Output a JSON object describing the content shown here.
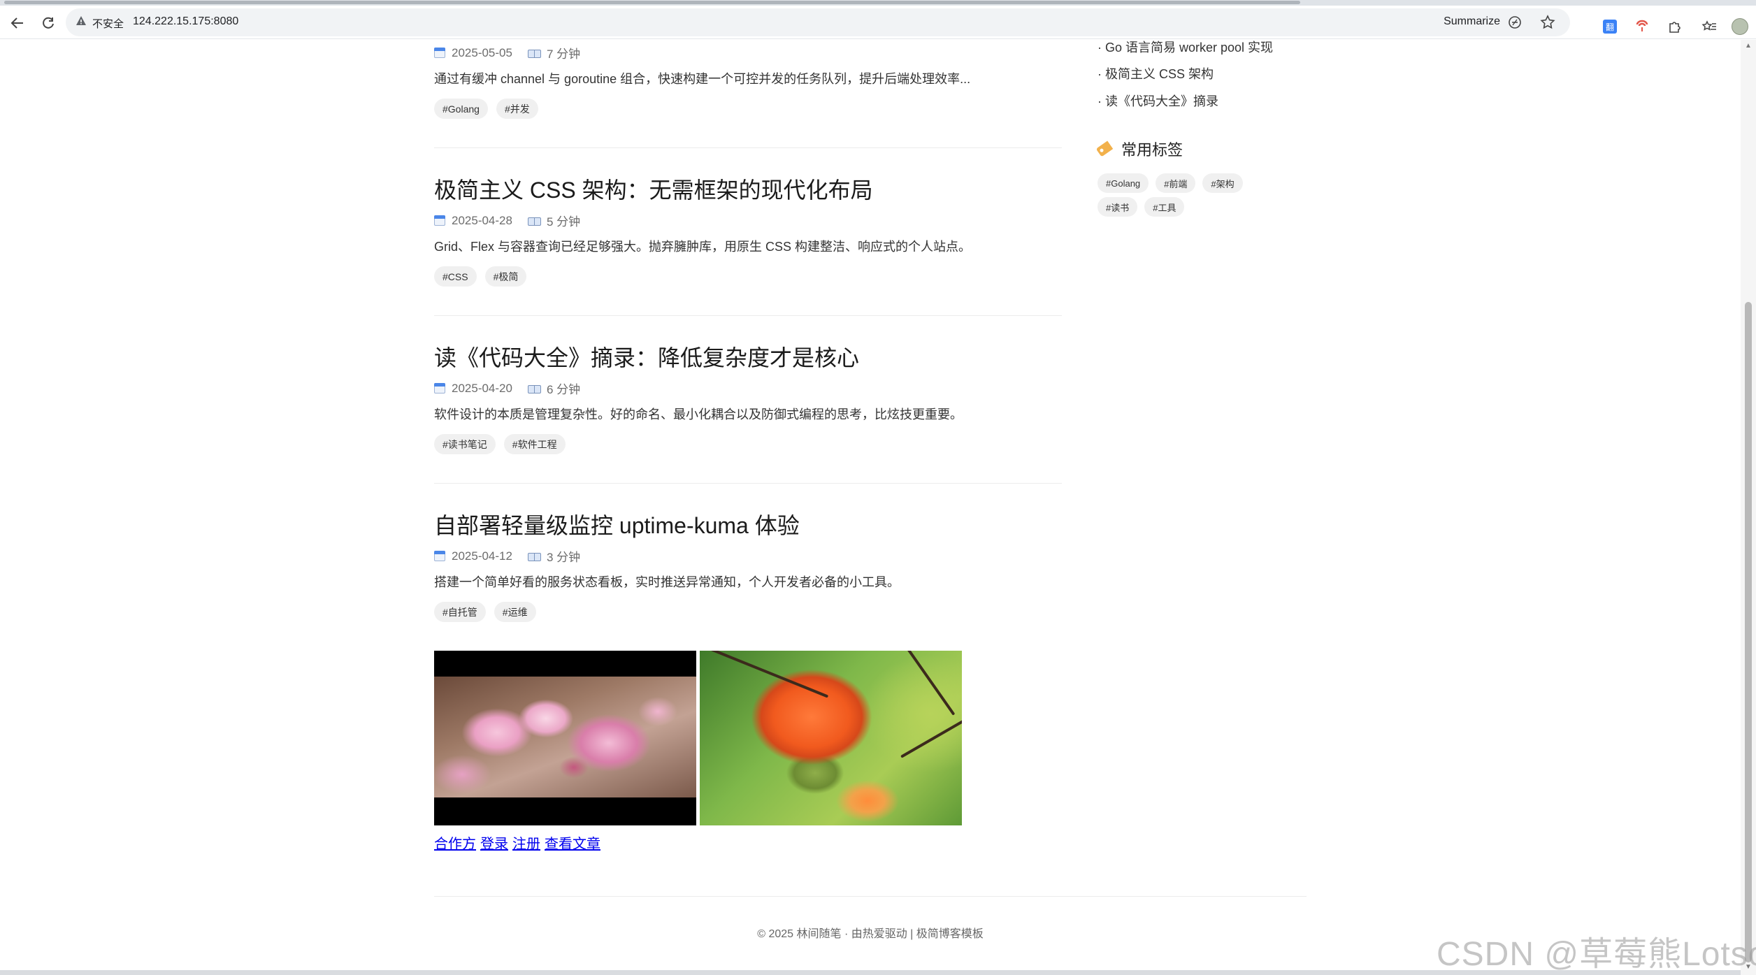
{
  "browser": {
    "security_label": "不安全",
    "url": "124.222.15.175:8080",
    "summarize_label": "Summarize",
    "extension_badge": "翻"
  },
  "articles": [
    {
      "title": "",
      "date": "2025-05-05",
      "read_time": "7 分钟",
      "excerpt": "通过有缓冲 channel 与 goroutine 组合，快速构建一个可控并发的任务队列，提升后端处理效率...",
      "tags": [
        "#Golang",
        "#并发"
      ]
    },
    {
      "title": "极简主义 CSS 架构：无需框架的现代化布局",
      "date": "2025-04-28",
      "read_time": "5 分钟",
      "excerpt": "Grid、Flex 与容器查询已经足够强大。抛弃臃肿库，用原生 CSS 构建整洁、响应式的个人站点。",
      "tags": [
        "#CSS",
        "#极简"
      ]
    },
    {
      "title": "读《代码大全》摘录：降低复杂度才是核心",
      "date": "2025-04-20",
      "read_time": "6 分钟",
      "excerpt": "软件设计的本质是管理复杂性。好的命名、最小化耦合以及防御式编程的思考，比炫技更重要。",
      "tags": [
        "#读书笔记",
        "#软件工程"
      ]
    },
    {
      "title": "自部署轻量级监控 uptime-kuma 体验",
      "date": "2025-04-12",
      "read_time": "3 分钟",
      "excerpt": "搭建一个简单好看的服务状态看板，实时推送异常通知，个人开发者必备的小工具。",
      "tags": [
        "#自托管",
        "#运维"
      ]
    }
  ],
  "links": [
    "合作方",
    "登录",
    "注册",
    "查看文章"
  ],
  "sidebar": {
    "recent": [
      "· Go 语言简易 worker pool 实现",
      "· 极简主义 CSS 架构",
      "· 读《代码大全》摘录"
    ],
    "tags_heading": "常用标签",
    "tags_row1": [
      "#Golang",
      "#前端",
      "#架构"
    ],
    "tags_row2": [
      "#读书",
      "#工具"
    ]
  },
  "footer": "© 2025 林间随笔 · 由热爱驱动 | 极简博客模板",
  "watermark": "CSDN @草莓熊Lotso"
}
